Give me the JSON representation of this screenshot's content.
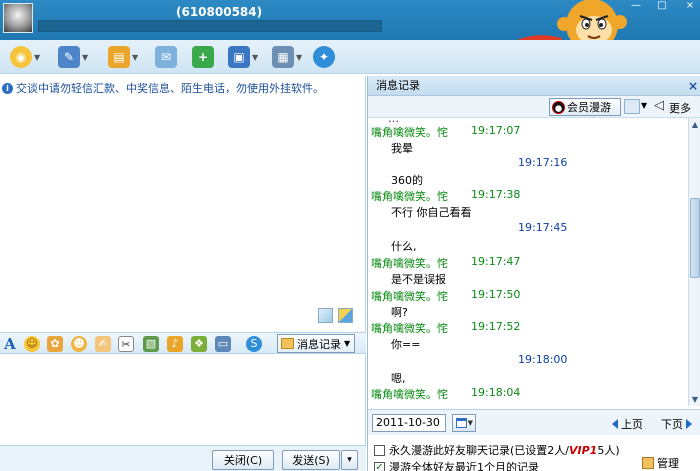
{
  "window": {
    "title": "(610800584)",
    "min": "—",
    "max": "□",
    "close": "×"
  },
  "notice": {
    "text": "交谈中请勿轻信汇款、中奖信息、陌生电话，勿使用外挂软件。"
  },
  "format_bar": {
    "font_icon": "A",
    "history_button": "消息记录"
  },
  "buttons": {
    "close": "关闭(C)",
    "send": "发送(S)",
    "send_dropdown": "▾"
  },
  "history_panel": {
    "title": "消息记录",
    "close": "×",
    "roam_button": "会员漫游",
    "more": "更多",
    "messages": [
      {
        "type": "header",
        "sender": "嘴角噙微笑。㤞",
        "time": "19:17:07"
      },
      {
        "type": "text",
        "text": "我晕"
      },
      {
        "type": "mytime",
        "time": "19:17:16"
      },
      {
        "type": "text",
        "text": "360的",
        "indent": "none"
      },
      {
        "type": "header",
        "sender": "嘴角噙微笑。㤞",
        "time": "19:17:38"
      },
      {
        "type": "text",
        "text": "不行 你自己看看"
      },
      {
        "type": "mytime",
        "time": "19:17:45"
      },
      {
        "type": "text",
        "text": "什么,"
      },
      {
        "type": "header",
        "sender": "嘴角噙微笑。㤞",
        "time": "19:17:47"
      },
      {
        "type": "text",
        "text": "是不是误报"
      },
      {
        "type": "header",
        "sender": "嘴角噙微笑。㤞",
        "time": "19:17:50"
      },
      {
        "type": "text",
        "text": "啊?"
      },
      {
        "type": "header",
        "sender": "嘴角噙微笑。㤞",
        "time": "19:17:52"
      },
      {
        "type": "text",
        "text": "你=="
      },
      {
        "type": "mytime",
        "time": "19:18:00"
      },
      {
        "type": "text",
        "text": "嗯,"
      },
      {
        "type": "header",
        "sender": "嘴角噙微笑。㤞",
        "time": "19:18:04"
      }
    ],
    "date": "2011-10-30",
    "prev_page": "上页",
    "next_page": "下页",
    "option1_pre": "永久漫游此好友聊天记录(已设置2人/",
    "option1_vip": "VIP",
    "option1_num": "1",
    "option1_post": "5人)",
    "option2": "漫游全体好友最近1个月的记录",
    "manage": "管理"
  }
}
